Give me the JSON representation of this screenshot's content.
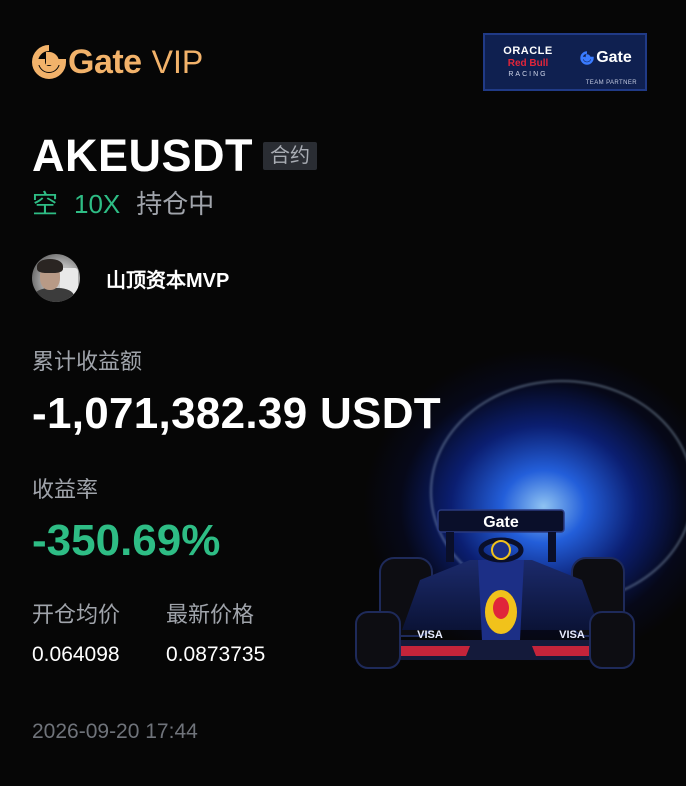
{
  "brand": {
    "word": "Gate",
    "tier": "VIP",
    "accent_color": "#f2b26a"
  },
  "partner_badge": {
    "line1": "ORACLE",
    "line2": "Red Bull",
    "line3": "RACING",
    "gate_word": "Gate",
    "caption": "TEAM PARTNER"
  },
  "position": {
    "pair": "AKEUSDT",
    "type_tag": "合约",
    "direction": "空",
    "leverage": "10X",
    "status": "持仓中"
  },
  "user": {
    "name": "山顶资本MVP",
    "avatar_icon": "avatar-photo"
  },
  "stats": {
    "pnl_label": "累计收益额",
    "pnl_value": "-1,071,382.39 USDT",
    "roi_label": "收益率",
    "roi_value": "-350.69%",
    "entry_label": "开仓均价",
    "entry_value": "0.064098",
    "latest_label": "最新价格",
    "latest_value": "0.0873735"
  },
  "timestamp": "2026-09-20 17:44",
  "colors": {
    "positive_green": "#2ebd85",
    "muted_text": "#a0a4ab",
    "background": "#060606"
  },
  "decor": {
    "car_text": "Gate",
    "sponsor_text": "VISA"
  }
}
